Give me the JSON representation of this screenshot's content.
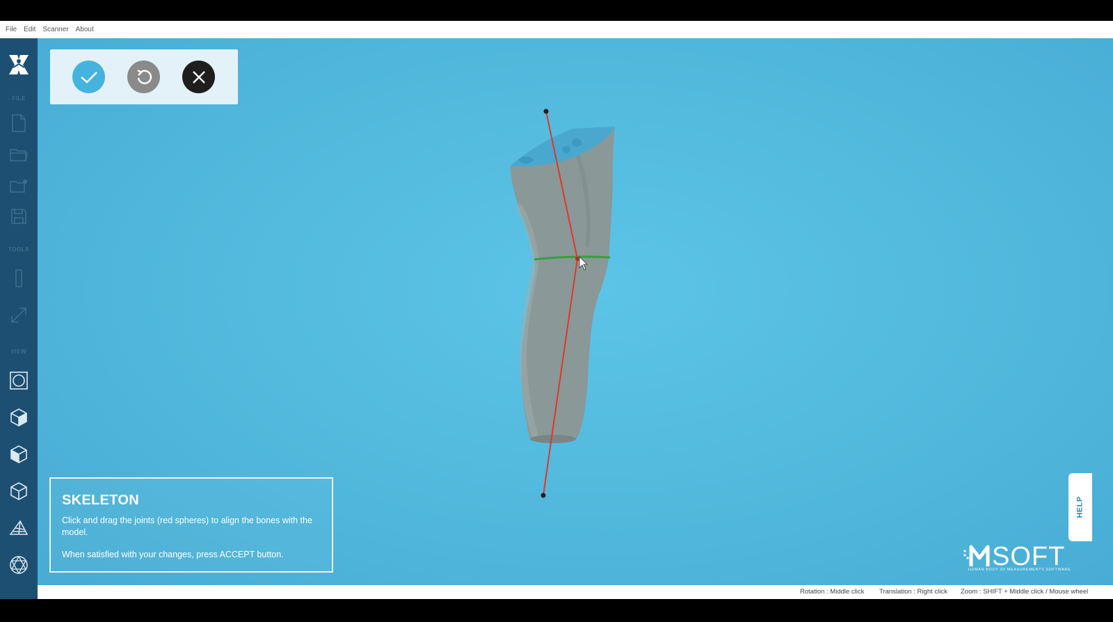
{
  "menu": [
    "File",
    "Edit",
    "Scanner",
    "About"
  ],
  "sidebar": {
    "sections": {
      "file": "FILE",
      "tools": "TOOLS",
      "view": "VIEW"
    },
    "icons": [
      "new-file-icon",
      "open-folder-icon",
      "import-icon",
      "save-icon",
      "ruler-icon",
      "measure-icon",
      "view-fit-icon",
      "cube-front-icon",
      "cube-side-icon",
      "cube-top-icon",
      "perspective-icon",
      "wireframe-icon"
    ]
  },
  "toolbox": {
    "accept": "accept",
    "reset": "reset",
    "cancel": "cancel",
    "colors": {
      "accept": "#46b3de",
      "reset": "#8a8a8a",
      "cancel": "#1e1e1e"
    }
  },
  "info": {
    "title": "SKELETON",
    "line1": "Click and drag the joints (red spheres) to align the bones with the model.",
    "line2": "When satisfied with your changes, press ACCEPT button."
  },
  "help": "HELP",
  "brand": {
    "name": "SOFT",
    "tagline": "HUMAN BODY 3D MEASUREMENTS SOFTWARE"
  },
  "status": {
    "rotation": "Rotation : Middle click",
    "translation": "Translation : Right click",
    "zoom": "Zoom : SHIFT + Middle click / Mouse wheel"
  },
  "colors": {
    "viewport": "#53bade",
    "sidebar": "#1d4f72",
    "bone": "#e0362a",
    "joint_ring": "#2fa33b"
  }
}
